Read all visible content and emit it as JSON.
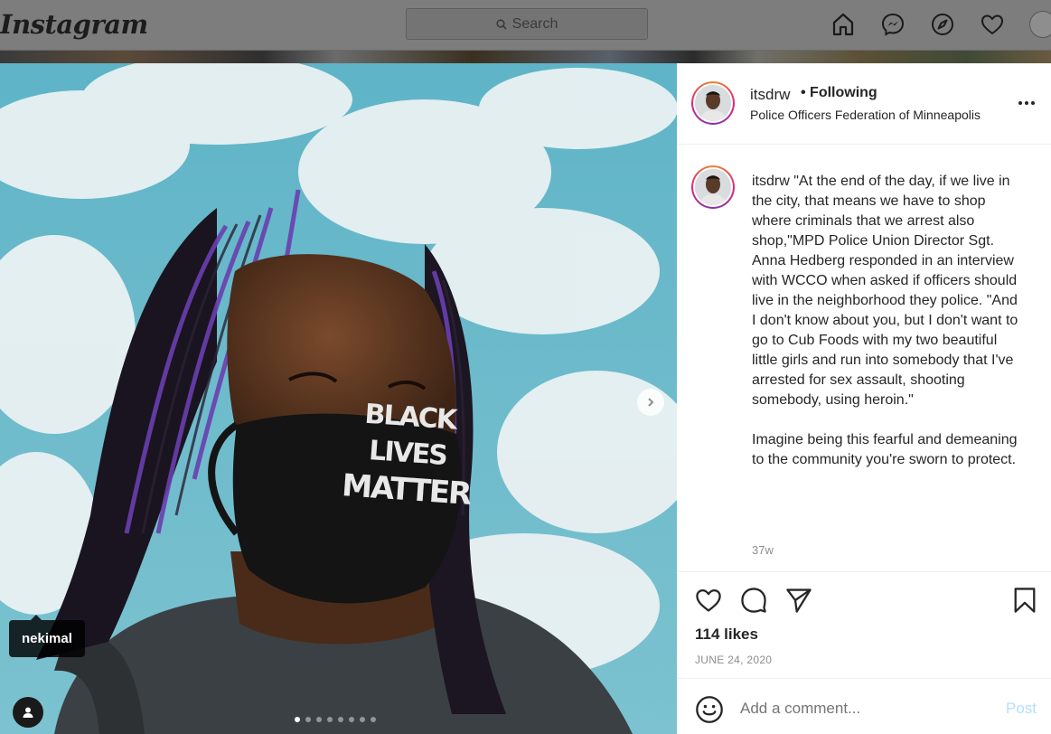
{
  "nav": {
    "logo": "Instagram",
    "search_placeholder": "Search"
  },
  "post": {
    "username": "itsdrw",
    "following_label": "• Following",
    "location": "Police Officers Federation of Minneapolis",
    "caption": "\"At the end of the day, if we live in the city, that means we have to shop where criminals that we arrest also shop,\"MPD Police Union Director Sgt. Anna Hedberg responded in an interview with WCCO when asked if officers should live in the neighborhood they police. \"And I don't know about you, but I don't want to go to Cub Foods with my two beautiful little girls and run into somebody that I've arrested for sex assault, shooting somebody, using heroin.\"\n\nImagine being this fearful and demeaning to the community you're sworn to protect.",
    "time_ago": "37w",
    "likes": "114 likes",
    "date": "JUNE 24, 2020"
  },
  "photo": {
    "mask_text_line1": "BLACK LIVES",
    "mask_text_line2": "MATTER",
    "tagged_user": "nekimal",
    "carousel_count": 8,
    "carousel_active": 0
  },
  "comment": {
    "placeholder": "Add a comment...",
    "post_label": "Post"
  },
  "colors": {
    "accent_blue": "#0095f6",
    "post_disabled": "#b2dffc",
    "muted_text": "#8e8e8e"
  }
}
